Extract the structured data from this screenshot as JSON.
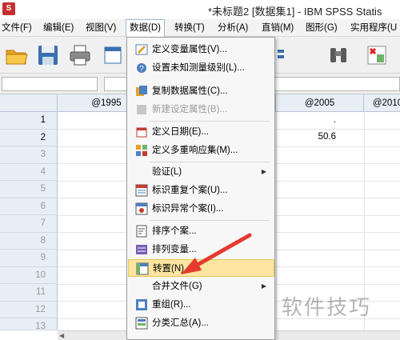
{
  "title": "*未标题2 [数据集1] - IBM SPSS Statis",
  "menubar": [
    {
      "label": "文件(F)"
    },
    {
      "label": "编辑(E)"
    },
    {
      "label": "视图(V)"
    },
    {
      "label": "数据(D)"
    },
    {
      "label": "转换(T)"
    },
    {
      "label": "分析(A)"
    },
    {
      "label": "直销(M)"
    },
    {
      "label": "图形(G)"
    },
    {
      "label": "实用程序(U"
    }
  ],
  "columns": [
    "@1995",
    "@2005",
    "@2010"
  ],
  "rows": [
    "1",
    "2",
    "3",
    "4",
    "5",
    "6",
    "7",
    "8",
    "9",
    "10",
    "11",
    "12",
    "13"
  ],
  "cells": {
    "r1c2": ".",
    "r2c2": "50.6"
  },
  "dropdown": [
    {
      "label": "定义变量属性(V)..."
    },
    {
      "label": "设置未知测量级别(L)..."
    },
    {
      "label": "复制数据属性(C)..."
    },
    {
      "label": "新建设定属性(B)..."
    },
    {
      "label": "定义日期(E)..."
    },
    {
      "label": "定义多重响应集(M)..."
    },
    {
      "label": "验证(L)"
    },
    {
      "label": "标识重复个案(U)..."
    },
    {
      "label": "标识异常个案(I)..."
    },
    {
      "label": "排序个案..."
    },
    {
      "label": "排列变量..."
    },
    {
      "label": "转置(N)..."
    },
    {
      "label": "合并文件(G)"
    },
    {
      "label": "重组(R)..."
    },
    {
      "label": "分类汇总(A)..."
    }
  ],
  "watermark": "软件技巧",
  "colors": {
    "highlight": "#fbe59f",
    "arrow": "#e53a2f",
    "header_bg": "#e8eef6"
  }
}
